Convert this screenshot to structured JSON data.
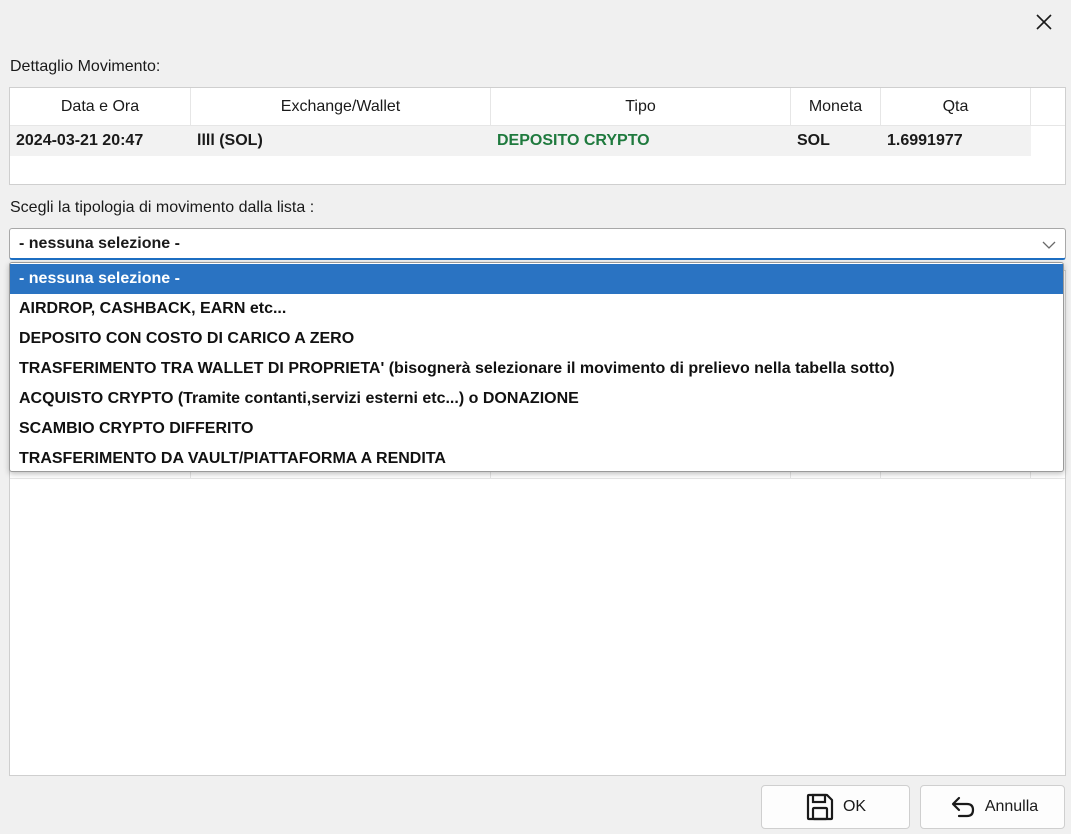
{
  "dialog": {
    "close_glyph": "✕"
  },
  "detail": {
    "label": "Dettaglio Movimento:",
    "columns": [
      "Data e Ora",
      "Exchange/Wallet",
      "Tipo",
      "Moneta",
      "Qta"
    ],
    "row": {
      "datetime": "2024-03-21 20:47",
      "wallet": "llll (SOL)",
      "tipo": "DEPOSITO CRYPTO",
      "moneta": "SOL",
      "qta": "1.6991977"
    },
    "tipo_color": "#1f7a3e"
  },
  "selection": {
    "label": "Scegli la tipologia di movimento dalla lista :",
    "current_value": "- nessuna selezione -",
    "options": [
      "- nessuna selezione -",
      "AIRDROP, CASHBACK, EARN etc...",
      "DEPOSITO CON COSTO DI CARICO A ZERO",
      "TRASFERIMENTO TRA WALLET DI PROPRIETA' (bisognerà selezionare il movimento di prelievo nella tabella sotto)",
      "ACQUISTO CRYPTO (Tramite contanti,servizi esterni etc...) o DONAZIONE",
      "SCAMBIO CRYPTO DIFFERITO",
      "TRASFERIMENTO DA VAULT/PIATTAFORMA A RENDITA"
    ],
    "selected_index": 0,
    "highlight_color": "#2a73c2"
  },
  "buttons": {
    "ok_label": "OK",
    "cancel_label": "Annulla"
  },
  "icons": {
    "close": "close-icon",
    "dropdown": "chevron-down-icon",
    "ok": "save-icon",
    "cancel": "undo-icon"
  }
}
